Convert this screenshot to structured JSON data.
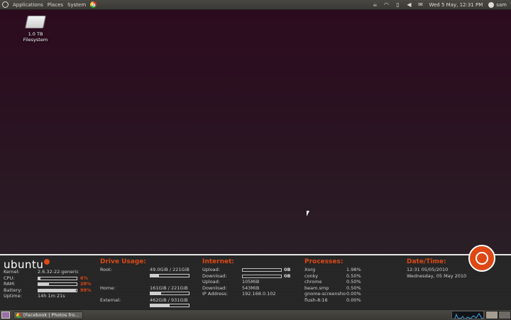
{
  "top_panel": {
    "menus": [
      "Applications",
      "Places",
      "System"
    ],
    "clock": "Wed  5 May, 12:31 PM",
    "user": "sam"
  },
  "desktop": {
    "icons": [
      {
        "label": "1.0 TB Filesystem",
        "icon": "drive-icon"
      }
    ]
  },
  "conky": {
    "brand": "ubuntu",
    "system": {
      "rows": [
        {
          "label": "Kernel:",
          "value": "2.6.32-22-generic"
        },
        {
          "label": "CPU:",
          "value": "6%",
          "fill": 0.06
        },
        {
          "label": "RAM:",
          "value": "28%",
          "fill": 0.28
        },
        {
          "label": "Battery:",
          "value": "99%",
          "fill": 0.99
        },
        {
          "label": "Uptime:",
          "value": "14h 1m 21s"
        }
      ]
    },
    "drive": {
      "title": "Drive Usage:",
      "rows": [
        {
          "label": "Root:",
          "value": "49.0GiB / 221GiB",
          "fill": 0.22
        },
        {
          "label": "Home:",
          "value": "161GiB / 221GiB",
          "fill": 0.28
        },
        {
          "label": "External:",
          "value": "462GiB / 931GiB",
          "fill": 0.5
        }
      ]
    },
    "internet": {
      "title": "Internet:",
      "rows": [
        {
          "label": "Upload:",
          "value": "0B"
        },
        {
          "label": "Download:",
          "value": "0B"
        },
        {
          "label": "Upload:",
          "value": "105MiB"
        },
        {
          "label": "Download:",
          "value": "543MiB"
        },
        {
          "label": "IP Address:",
          "value": "192.168.0.102"
        }
      ]
    },
    "processes": {
      "title": "Processes:",
      "rows": [
        {
          "name": "Xorg",
          "value": "1.98%"
        },
        {
          "name": "conky",
          "value": "0.50%"
        },
        {
          "name": "chrome",
          "value": "0.50%"
        },
        {
          "name": "beam.smp",
          "value": "0.50%"
        },
        {
          "name": "gnome-screensho",
          "value": "0.00%"
        },
        {
          "name": "flush-8:16",
          "value": "0.00%"
        }
      ]
    },
    "datetime": {
      "title": "Date/Time:",
      "line1": "12:31  05/05/2010",
      "line2": "Wednesday, 05 May 2010"
    }
  },
  "bottom_panel": {
    "task_label": "[Facebook | Photos fro..."
  },
  "colors": {
    "accent": "#dd4814"
  }
}
